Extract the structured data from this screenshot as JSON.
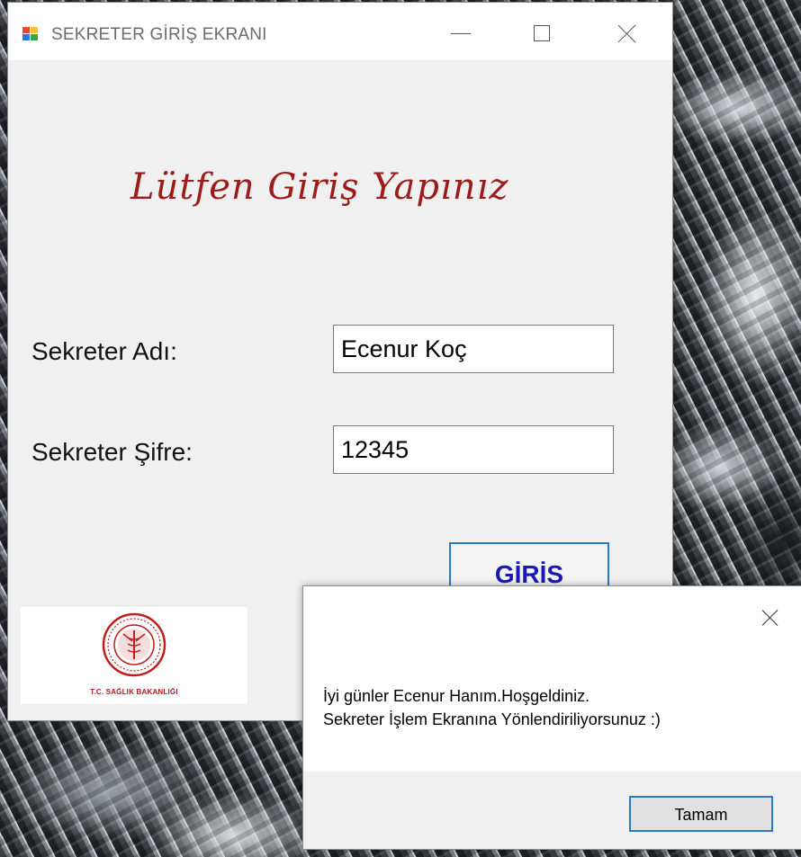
{
  "window": {
    "title": "SEKRETER GİRİŞ EKRANI",
    "icon": "app-icon"
  },
  "form": {
    "heading": "Lütfen Giriş Yapınız",
    "name_label": "Sekreter Adı:",
    "name_value": "Ecenur Koç",
    "password_label": "Sekreter Şifre:",
    "password_value": "12345",
    "login_button": "GİRİS",
    "logo_caption": "T.C. SAĞLIK BAKANLIĞI"
  },
  "dialog": {
    "line1": "İyi günler Ecenur Hanım.Hoşgeldiniz.",
    "line2": "Sekreter İşlem Ekranına Yönlendiriliyorsunuz :)",
    "ok_button": "Tamam"
  },
  "colors": {
    "heading": "#9c1b1b",
    "login_text": "#1a1ab8",
    "focus_border": "#2878d0"
  }
}
